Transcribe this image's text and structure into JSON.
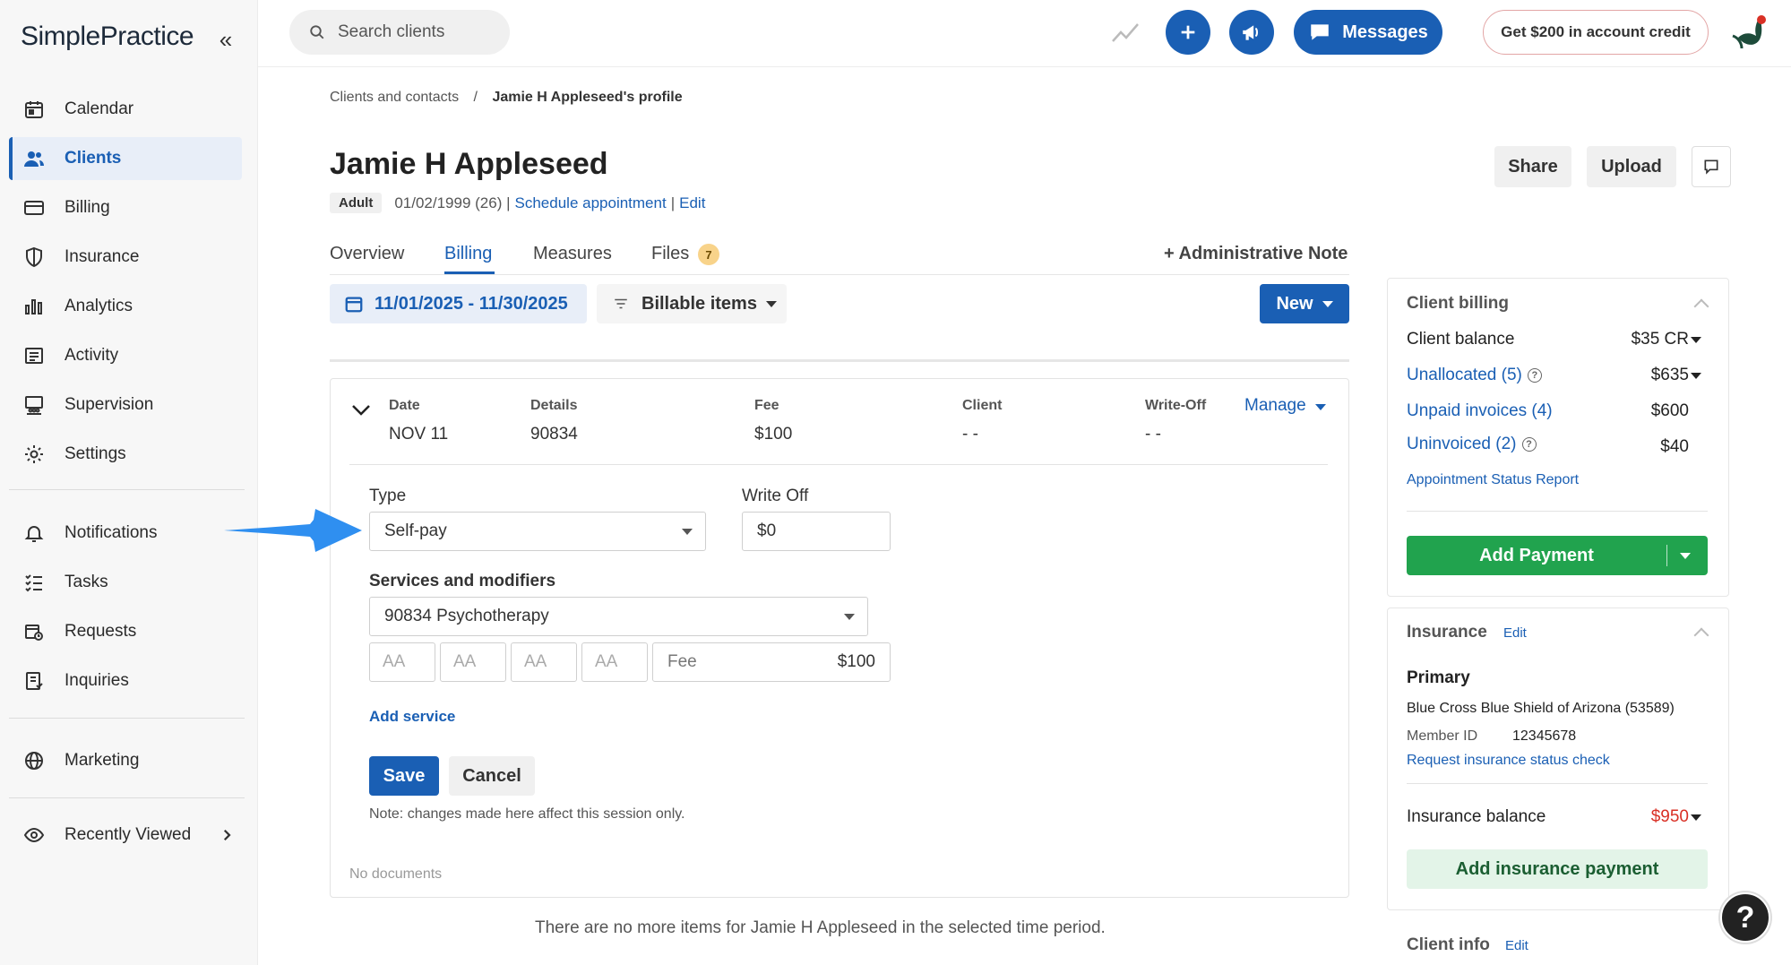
{
  "app": {
    "logo": "SimplePractice",
    "collapse": "«"
  },
  "sidebar": {
    "items": [
      {
        "label": "Calendar"
      },
      {
        "label": "Clients"
      },
      {
        "label": "Billing"
      },
      {
        "label": "Insurance"
      },
      {
        "label": "Analytics"
      },
      {
        "label": "Activity"
      },
      {
        "label": "Supervision"
      },
      {
        "label": "Settings"
      },
      {
        "label": "Notifications"
      },
      {
        "label": "Tasks"
      },
      {
        "label": "Requests"
      },
      {
        "label": "Inquiries"
      },
      {
        "label": "Marketing"
      },
      {
        "label": "Recently Viewed"
      }
    ]
  },
  "topbar": {
    "search_placeholder": "Search clients",
    "messages_label": "Messages",
    "credit_label": "Get $200 in account credit"
  },
  "breadcrumb": {
    "parent": "Clients and contacts",
    "separator": "/",
    "current": "Jamie H Appleseed's profile"
  },
  "client": {
    "name": "Jamie H Appleseed",
    "badge": "Adult",
    "dob": "01/02/1999 (26) |",
    "schedule_link": "Schedule appointment",
    "pipe": "|",
    "edit_link": "Edit"
  },
  "header_actions": {
    "share": "Share",
    "upload": "Upload"
  },
  "tabs": [
    {
      "label": "Overview"
    },
    {
      "label": "Billing"
    },
    {
      "label": "Measures"
    },
    {
      "label": "Files"
    }
  ],
  "files_count": "7",
  "admin_note": "+ Administrative Note",
  "toolbar": {
    "date_range": "11/01/2025 - 11/30/2025",
    "filter_label": "Billable items",
    "new_label": "New"
  },
  "billing_row": {
    "headers": [
      "Date",
      "Details",
      "Fee",
      "Client",
      "Write-Off"
    ],
    "values": [
      "NOV 11",
      "90834",
      "$100",
      "- -",
      "- -"
    ],
    "manage": "Manage"
  },
  "form": {
    "type_label": "Type",
    "type_value": "Self-pay",
    "writeoff_label": "Write Off",
    "writeoff_value": "$0",
    "services_label": "Services and modifiers",
    "service_value": "90834 Psychotherapy",
    "modifier_placeholder": "AA",
    "fee_label": "Fee",
    "fee_value": "$100",
    "add_service": "Add service",
    "save": "Save",
    "cancel": "Cancel",
    "note": "Note: changes made here affect this session only."
  },
  "no_documents": "No documents",
  "empty_message": "There are no more items for Jamie H Appleseed in the selected time period.",
  "client_billing": {
    "title": "Client billing",
    "rows": [
      {
        "label": "Client balance",
        "value": "$35 CR"
      },
      {
        "label": "Unallocated (5)",
        "value": "$635"
      },
      {
        "label": "Unpaid invoices (4)",
        "value": "$600"
      },
      {
        "label": "Uninvoiced (2)",
        "value": "$40"
      }
    ],
    "report_link": "Appointment Status Report",
    "add_payment": "Add Payment"
  },
  "insurance": {
    "title": "Insurance",
    "edit": "Edit",
    "primary": "Primary",
    "payer": "Blue Cross Blue Shield of Arizona (53589)",
    "member_label": "Member ID",
    "member_id": "12345678",
    "status_link": "Request insurance status check",
    "balance_label": "Insurance balance",
    "balance_value": "$950",
    "add_insurance_payment": "Add insurance payment"
  },
  "client_info": {
    "title": "Client info",
    "edit": "Edit"
  },
  "help": "?",
  "colors": {
    "primary": "#1a5fb4",
    "success": "#21a34e",
    "danger": "#d93025",
    "arrow": "#2f8ff0"
  }
}
